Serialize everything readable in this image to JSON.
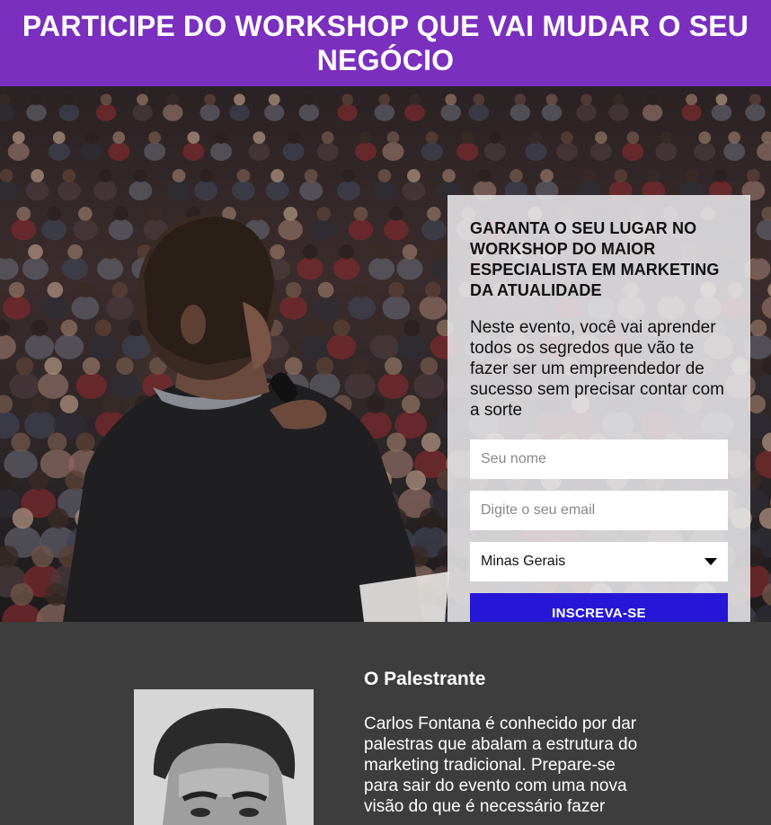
{
  "header": {
    "title": "PARTICIPE DO WORKSHOP QUE VAI MUDAR O SEU NEGÓCIO"
  },
  "form": {
    "heading": "GARANTA O SEU LUGAR NO WORKSHOP DO MAIOR ESPECIALISTA EM MARKETING DA ATUALIDADE",
    "lead": "Neste evento, você vai aprender todos os segredos que vão te fazer ser um empreendedor de sucesso sem precisar contar com a sorte",
    "name_placeholder": "Seu nome",
    "email_placeholder": "Digite o seu email",
    "state_selected": "Minas Gerais",
    "submit_label": "INSCREVA-SE"
  },
  "speaker": {
    "title": "O Palestrante",
    "bio": "Carlos Fontana é conhecido por dar palestras que abalam a estrutura do marketing tradicional. Prepare-se para sair do evento com uma nova visão do que é necessário fazer"
  },
  "colors": {
    "header_bg": "#7b2fbe",
    "button_bg": "#2617d6",
    "section_bg": "#3d3d3d"
  },
  "icons": {
    "select_caret": "chevron-down-icon"
  }
}
